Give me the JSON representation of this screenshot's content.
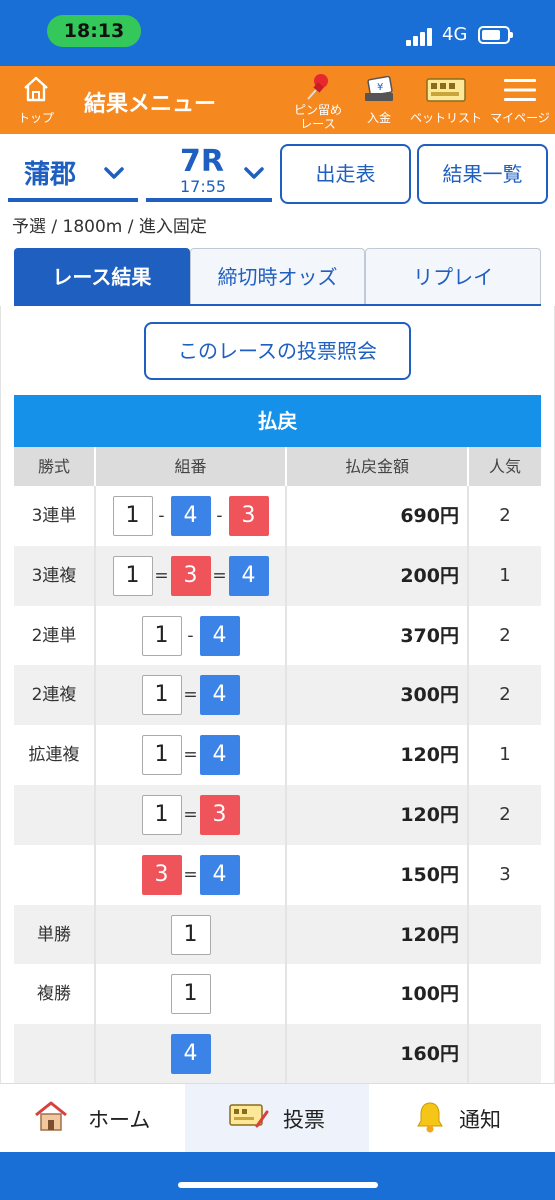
{
  "status": {
    "time": "18:13",
    "network": "4G"
  },
  "header": {
    "top_label": "トップ",
    "title": "結果メニュー",
    "pin_label_1": "ピン留め",
    "pin_label_2": "レース",
    "deposit_label": "入金",
    "betlist_label": "ベットリスト",
    "mypage_label": "マイページ"
  },
  "race": {
    "venue": "蒲郡",
    "number": "7R",
    "time": "17:55",
    "info": "予選 / 1800m / 進入固定",
    "entries_button": "出走表",
    "results_list_button": "結果一覧"
  },
  "tabs": [
    {
      "label": "レース結果",
      "active": true
    },
    {
      "label": "締切時オッズ",
      "active": false
    },
    {
      "label": "リプレイ",
      "active": false
    }
  ],
  "inquiry_button": "このレースの投票照会",
  "payout": {
    "title": "払戻",
    "headers": {
      "kind": "勝式",
      "combo": "組番",
      "amount": "払戻金額",
      "popularity": "人気"
    },
    "rows": [
      {
        "kind": "3連単",
        "boats": [
          "1",
          "4",
          "3"
        ],
        "seps": [
          "-",
          "-"
        ],
        "amount": "690円",
        "popularity": "2"
      },
      {
        "kind": "3連複",
        "boats": [
          "1",
          "3",
          "4"
        ],
        "seps": [
          "=",
          "="
        ],
        "amount": "200円",
        "popularity": "1"
      },
      {
        "kind": "2連単",
        "boats": [
          "1",
          "4"
        ],
        "seps": [
          "-"
        ],
        "amount": "370円",
        "popularity": "2"
      },
      {
        "kind": "2連複",
        "boats": [
          "1",
          "4"
        ],
        "seps": [
          "="
        ],
        "amount": "300円",
        "popularity": "2"
      },
      {
        "kind": "拡連複",
        "boats": [
          "1",
          "4"
        ],
        "seps": [
          "="
        ],
        "amount": "120円",
        "popularity": "1"
      },
      {
        "kind": "",
        "boats": [
          "1",
          "3"
        ],
        "seps": [
          "="
        ],
        "amount": "120円",
        "popularity": "2"
      },
      {
        "kind": "",
        "boats": [
          "3",
          "4"
        ],
        "seps": [
          "="
        ],
        "amount": "150円",
        "popularity": "3"
      },
      {
        "kind": "単勝",
        "boats": [
          "1"
        ],
        "seps": [],
        "amount": "120円",
        "popularity": ""
      },
      {
        "kind": "複勝",
        "boats": [
          "1"
        ],
        "seps": [],
        "amount": "100円",
        "popularity": ""
      },
      {
        "kind": "",
        "boats": [
          "4"
        ],
        "seps": [],
        "amount": "160円",
        "popularity": ""
      }
    ]
  },
  "bottom_nav": {
    "home": "ホーム",
    "vote": "投票",
    "notify": "通知"
  },
  "colors": {
    "header": "#f5891f",
    "primary": "#1e5fc0",
    "boat1": "#ffffff",
    "boat3": "#f0545b",
    "boat4": "#3b83e6"
  }
}
